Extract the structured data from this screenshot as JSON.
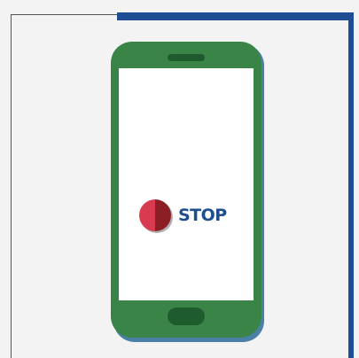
{
  "stop_control": {
    "label": "STOP",
    "icon": "stop-circle-icon"
  },
  "colors": {
    "phone_body": "#3b8448",
    "phone_accent": "#1f5c2d",
    "frame_blue": "#1f4e95",
    "stop_red": "#d83a4f",
    "stop_dark_red": "#8c1e26",
    "label_blue": "#1f4e8f"
  }
}
